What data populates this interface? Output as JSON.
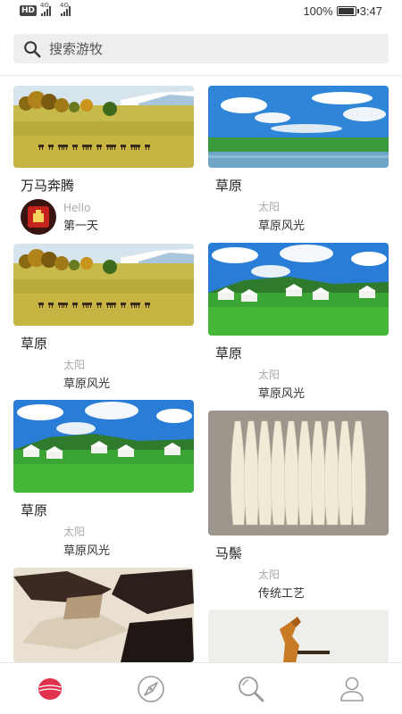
{
  "status_bar": {
    "badge": "HD",
    "signal_1_label": "4G",
    "signal_2_label": "4G",
    "battery_text": "100%",
    "battery_level": 1.0,
    "time": "3:47"
  },
  "search": {
    "placeholder": "搜索游牧",
    "icon": "search-icon"
  },
  "cards": [
    {
      "title": "万马奔腾",
      "author": "Hello",
      "subtitle": "第一天",
      "has_avatar": true,
      "image": "horses-plain"
    },
    {
      "title": "草原",
      "author": "太阳",
      "subtitle": "草原风光",
      "has_avatar": false,
      "image": "grassland-lake"
    },
    {
      "title": "草原",
      "author": "太阳",
      "subtitle": "草原风光",
      "has_avatar": false,
      "image": "horses-plain"
    },
    {
      "title": "草原",
      "author": "太阳",
      "subtitle": "草原风光",
      "has_avatar": false,
      "image": "yurts-grassland"
    },
    {
      "title": "草原",
      "author": "太阳",
      "subtitle": "草原风光",
      "has_avatar": false,
      "image": "yurts-grassland"
    },
    {
      "title": "马鬃",
      "author": "太阳",
      "subtitle": "传统工艺",
      "has_avatar": false,
      "image": "horsehair"
    },
    {
      "title": "",
      "author": "",
      "subtitle": "",
      "has_avatar": false,
      "image": "hides"
    },
    {
      "title": "",
      "author": "",
      "subtitle": "",
      "has_avatar": false,
      "image": "horse-figure"
    }
  ],
  "bottom_nav": {
    "items": [
      {
        "icon": "home-icon",
        "active": true
      },
      {
        "icon": "compass-icon",
        "active": false
      },
      {
        "icon": "search-icon",
        "active": false
      },
      {
        "icon": "profile-icon",
        "active": false
      }
    ],
    "active_color": "#e0314f",
    "inactive_color": "#9a9a9a"
  }
}
